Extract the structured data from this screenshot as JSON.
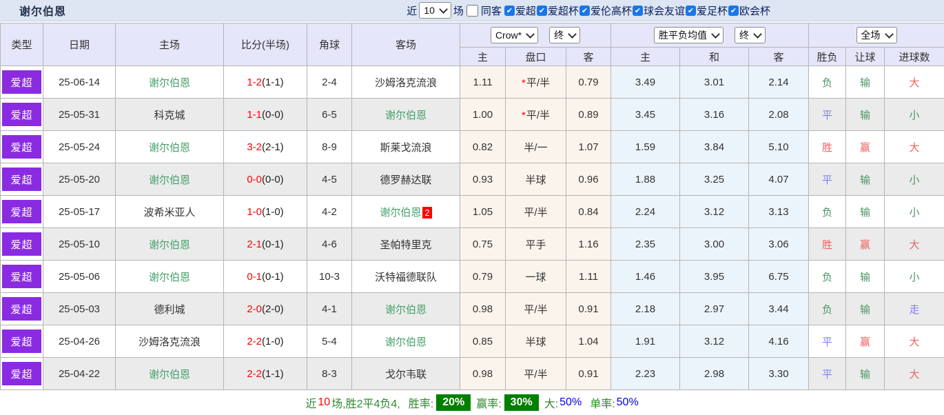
{
  "topbar": {
    "title": "谢尔伯恩",
    "recent_label": "近",
    "recent_value": "10",
    "games_label": "场",
    "same_opponent_label": "同客",
    "competitions": [
      "爱超",
      "爱超杯",
      "爱伦高杯",
      "球会友谊",
      "爱足杯",
      "欧会杯"
    ]
  },
  "table": {
    "columns": {
      "type": "类型",
      "date": "日期",
      "home": "主场",
      "score": "比分(半场)",
      "corner": "角球",
      "away": "客场",
      "ah_home": "主",
      "ah_line": "盘口",
      "ah_away": "客",
      "eu_home": "主",
      "eu_draw": "和",
      "eu_away": "客",
      "wdl": "胜负",
      "handicap": "让球",
      "goals": "进球数"
    },
    "selects": {
      "company": "Crow*",
      "ah_time": "终",
      "europe": "胜平负均值",
      "eu_time": "终",
      "scope": "全场"
    },
    "rows": [
      {
        "league": "爱超",
        "date": "25-06-14",
        "home": "谢尔伯恩",
        "home_focus": true,
        "score": "1-2",
        "half": "(1-1)",
        "corner": "2-4",
        "away": "沙姆洛克流浪",
        "away_focus": false,
        "away_red": "",
        "ah_home": "1.11",
        "ah_star": true,
        "ah_line": "平/半",
        "ah_away": "0.79",
        "eu_home": "3.49",
        "eu_draw": "3.01",
        "eu_away": "2.14",
        "wdl": "负",
        "wdl_color": "green",
        "hcp": "输",
        "hcp_color": "green",
        "goal": "大",
        "goal_color": "red"
      },
      {
        "league": "爱超",
        "date": "25-05-31",
        "home": "科克城",
        "home_focus": false,
        "score": "1-1",
        "half": "(0-0)",
        "corner": "6-5",
        "away": "谢尔伯恩",
        "away_focus": true,
        "away_red": "",
        "ah_home": "1.00",
        "ah_star": true,
        "ah_line": "平/半",
        "ah_away": "0.89",
        "eu_home": "3.45",
        "eu_draw": "3.16",
        "eu_away": "2.08",
        "wdl": "平",
        "wdl_color": "blue",
        "hcp": "输",
        "hcp_color": "green",
        "goal": "小",
        "goal_color": "green"
      },
      {
        "league": "爱超",
        "date": "25-05-24",
        "home": "谢尔伯恩",
        "home_focus": true,
        "score": "3-2",
        "half": "(2-1)",
        "corner": "8-9",
        "away": "斯莱戈流浪",
        "away_focus": false,
        "away_red": "",
        "ah_home": "0.82",
        "ah_star": false,
        "ah_line": "半/一",
        "ah_away": "1.07",
        "eu_home": "1.59",
        "eu_draw": "3.84",
        "eu_away": "5.10",
        "wdl": "胜",
        "wdl_color": "red",
        "hcp": "赢",
        "hcp_color": "red",
        "goal": "大",
        "goal_color": "red"
      },
      {
        "league": "爱超",
        "date": "25-05-20",
        "home": "谢尔伯恩",
        "home_focus": true,
        "score": "0-0",
        "half": "(0-0)",
        "corner": "4-5",
        "away": "德罗赫达联",
        "away_focus": false,
        "away_red": "",
        "ah_home": "0.93",
        "ah_star": false,
        "ah_line": "半球",
        "ah_away": "0.96",
        "eu_home": "1.88",
        "eu_draw": "3.25",
        "eu_away": "4.07",
        "wdl": "平",
        "wdl_color": "blue",
        "hcp": "输",
        "hcp_color": "green",
        "goal": "小",
        "goal_color": "green"
      },
      {
        "league": "爱超",
        "date": "25-05-17",
        "home": "波希米亚人",
        "home_focus": false,
        "score": "1-0",
        "half": "(1-0)",
        "corner": "4-2",
        "away": "谢尔伯恩",
        "away_focus": true,
        "away_red": "2",
        "ah_home": "1.05",
        "ah_star": false,
        "ah_line": "平/半",
        "ah_away": "0.84",
        "eu_home": "2.24",
        "eu_draw": "3.12",
        "eu_away": "3.13",
        "wdl": "负",
        "wdl_color": "green",
        "hcp": "输",
        "hcp_color": "green",
        "goal": "小",
        "goal_color": "green"
      },
      {
        "league": "爱超",
        "date": "25-05-10",
        "home": "谢尔伯恩",
        "home_focus": true,
        "score": "2-1",
        "half": "(0-1)",
        "corner": "4-6",
        "away": "圣帕特里克",
        "away_focus": false,
        "away_red": "",
        "ah_home": "0.75",
        "ah_star": false,
        "ah_line": "平手",
        "ah_away": "1.16",
        "eu_home": "2.35",
        "eu_draw": "3.00",
        "eu_away": "3.06",
        "wdl": "胜",
        "wdl_color": "red",
        "hcp": "赢",
        "hcp_color": "red",
        "goal": "大",
        "goal_color": "red"
      },
      {
        "league": "爱超",
        "date": "25-05-06",
        "home": "谢尔伯恩",
        "home_focus": true,
        "score": "0-1",
        "half": "(0-1)",
        "corner": "10-3",
        "away": "沃特福德联队",
        "away_focus": false,
        "away_red": "",
        "ah_home": "0.79",
        "ah_star": false,
        "ah_line": "一球",
        "ah_away": "1.11",
        "eu_home": "1.46",
        "eu_draw": "3.95",
        "eu_away": "6.75",
        "wdl": "负",
        "wdl_color": "green",
        "hcp": "输",
        "hcp_color": "green",
        "goal": "小",
        "goal_color": "green"
      },
      {
        "league": "爱超",
        "date": "25-05-03",
        "home": "德利城",
        "home_focus": false,
        "score": "2-0",
        "half": "(2-0)",
        "corner": "4-1",
        "away": "谢尔伯恩",
        "away_focus": true,
        "away_red": "",
        "ah_home": "0.98",
        "ah_star": false,
        "ah_line": "平/半",
        "ah_away": "0.91",
        "eu_home": "2.18",
        "eu_draw": "2.97",
        "eu_away": "3.44",
        "wdl": "负",
        "wdl_color": "green",
        "hcp": "输",
        "hcp_color": "green",
        "goal": "走",
        "goal_color": "blue"
      },
      {
        "league": "爱超",
        "date": "25-04-26",
        "home": "沙姆洛克流浪",
        "home_focus": false,
        "score": "2-2",
        "half": "(1-0)",
        "corner": "5-4",
        "away": "谢尔伯恩",
        "away_focus": true,
        "away_red": "",
        "ah_home": "0.85",
        "ah_star": false,
        "ah_line": "半球",
        "ah_away": "1.04",
        "eu_home": "1.91",
        "eu_draw": "3.12",
        "eu_away": "4.16",
        "wdl": "平",
        "wdl_color": "blue",
        "hcp": "赢",
        "hcp_color": "red",
        "goal": "大",
        "goal_color": "red"
      },
      {
        "league": "爱超",
        "date": "25-04-22",
        "home": "谢尔伯恩",
        "home_focus": true,
        "score": "2-2",
        "half": "(1-1)",
        "corner": "8-3",
        "away": "戈尔韦联",
        "away_focus": false,
        "away_red": "",
        "ah_home": "0.98",
        "ah_star": false,
        "ah_line": "平/半",
        "ah_away": "0.91",
        "eu_home": "2.23",
        "eu_draw": "2.98",
        "eu_away": "3.30",
        "wdl": "平",
        "wdl_color": "blue",
        "hcp": "输",
        "hcp_color": "green",
        "goal": "大",
        "goal_color": "red"
      }
    ]
  },
  "footer": {
    "prefix_label": "近",
    "count": "10",
    "summary": "场,胜2平4负4,",
    "win_rate_label": "胜率:",
    "win_rate": "20%",
    "profit_rate_label": "赢率:",
    "profit_rate": "30%",
    "big_label": "大:",
    "big_value": "50%",
    "odd_label": "单率:",
    "odd_value": "50%"
  }
}
